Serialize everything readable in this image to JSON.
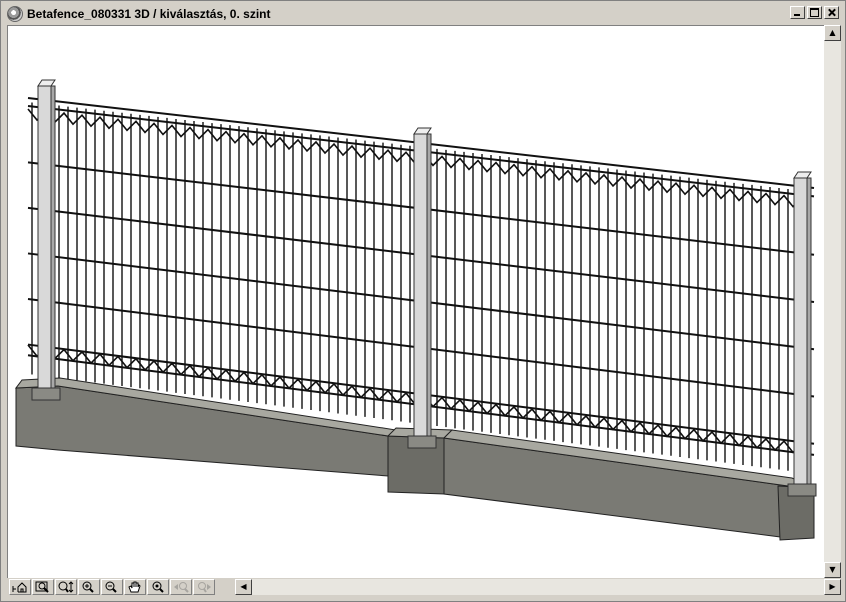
{
  "window": {
    "title": "Betafence_080331 3D / kiválasztás, 0. szint",
    "controls": [
      "minimize",
      "maximize",
      "close"
    ]
  },
  "viewport": {
    "content": "3D model: two-panel welded wire mesh fence on concrete base",
    "colors": {
      "background": "#ffffff",
      "mesh": "#111111",
      "post": "#d9d9d9",
      "base_top": "#a8a8a0",
      "base_front": "#7a7a74"
    }
  },
  "toolbar": {
    "tools": [
      {
        "icon": "home-view-icon",
        "enabled": true
      },
      {
        "icon": "fit-window-icon",
        "enabled": true
      },
      {
        "icon": "zoom-dynamic-icon",
        "enabled": true
      },
      {
        "icon": "zoom-in-icon",
        "enabled": true
      },
      {
        "icon": "zoom-out-icon",
        "enabled": true
      },
      {
        "icon": "pan-hand-icon",
        "enabled": true
      },
      {
        "icon": "orbit-icon",
        "enabled": true
      },
      {
        "icon": "previous-view-icon",
        "enabled": false
      },
      {
        "icon": "next-view-icon",
        "enabled": false
      }
    ]
  },
  "scrollbars": {
    "vertical": true,
    "horizontal": true
  }
}
